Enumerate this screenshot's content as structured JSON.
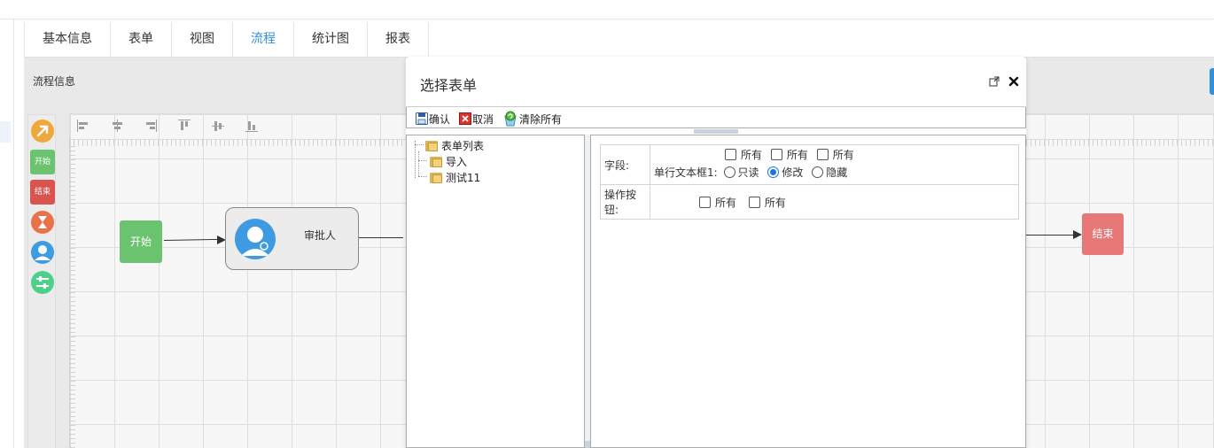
{
  "tabs": [
    {
      "label": "基本信息"
    },
    {
      "label": "表单"
    },
    {
      "label": "视图"
    },
    {
      "label": "流程",
      "active": true
    },
    {
      "label": "统计图"
    },
    {
      "label": "报表"
    }
  ],
  "workflow": {
    "section_label": "流程信息",
    "palette": {
      "start_label": "开始",
      "end_label": "结束"
    },
    "nodes": {
      "start": "开始",
      "approver": "审批人",
      "end": "结束"
    },
    "colors": {
      "start": "#6cc36f",
      "end": "#e87878",
      "approver_avatar": "#3e9ae1",
      "active_tab": "#2f8fe0"
    }
  },
  "modal": {
    "title": "选择表单",
    "toolbar": {
      "confirm": "确认",
      "cancel": "取消",
      "clear_all": "清除所有"
    },
    "tree": {
      "root": "表单列表",
      "children": [
        "导入",
        "测试11"
      ]
    },
    "permissions": {
      "field_label": "字段:",
      "all_label": "所有",
      "field_name": "单行文本框1:",
      "options": [
        "只读",
        "修改",
        "隐藏"
      ],
      "selected_option": "修改",
      "button_label": "操作按钮:"
    }
  }
}
